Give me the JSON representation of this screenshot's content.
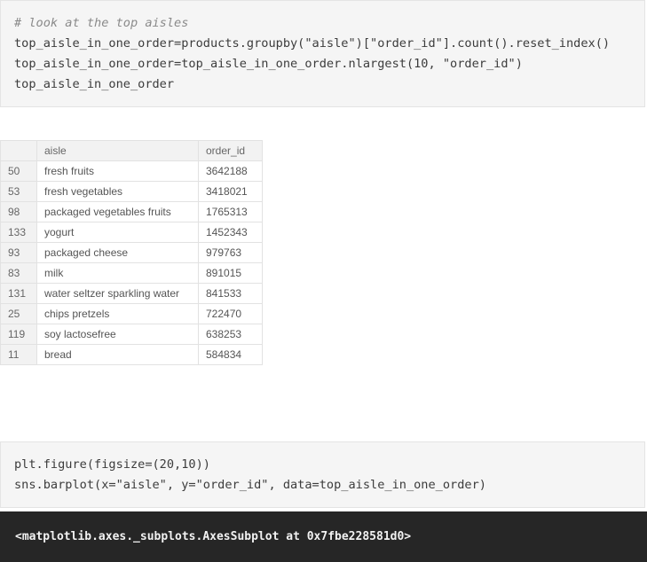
{
  "code_cell_1": {
    "lines": [
      "# look at the top aisles",
      "top_aisle_in_one_order=products.groupby(\"aisle\")[\"order_id\"].count().reset_index()",
      "top_aisle_in_one_order=top_aisle_in_one_order.nlargest(10, \"order_id\")",
      "top_aisle_in_one_order"
    ]
  },
  "dataframe": {
    "columns": [
      "",
      "aisle",
      "order_id"
    ],
    "rows": [
      {
        "index": "50",
        "aisle": "fresh fruits",
        "order_id": "3642188"
      },
      {
        "index": "53",
        "aisle": "fresh vegetables",
        "order_id": "3418021"
      },
      {
        "index": "98",
        "aisle": "packaged vegetables fruits",
        "order_id": "1765313"
      },
      {
        "index": "133",
        "aisle": "yogurt",
        "order_id": "1452343"
      },
      {
        "index": "93",
        "aisle": "packaged cheese",
        "order_id": "979763"
      },
      {
        "index": "83",
        "aisle": "milk",
        "order_id": "891015"
      },
      {
        "index": "131",
        "aisle": "water seltzer sparkling water",
        "order_id": "841533"
      },
      {
        "index": "25",
        "aisle": "chips pretzels",
        "order_id": "722470"
      },
      {
        "index": "119",
        "aisle": "soy lactosefree",
        "order_id": "638253"
      },
      {
        "index": "11",
        "aisle": "bread",
        "order_id": "584834"
      }
    ]
  },
  "code_cell_2": {
    "lines": [
      "plt.figure(figsize=(20,10))",
      "sns.barplot(x=\"aisle\", y=\"order_id\", data=top_aisle_in_one_order)"
    ]
  },
  "output": {
    "text": "<matplotlib.axes._subplots.AxesSubplot at 0x7fbe228581d0>"
  }
}
